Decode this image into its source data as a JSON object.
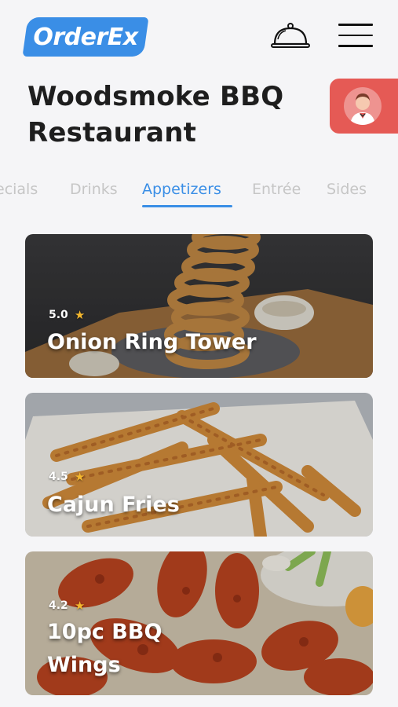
{
  "brand": {
    "logo_text": "OrderEx",
    "accent_color": "#3a8ee6",
    "highlight_color": "#e55a55"
  },
  "header": {
    "cloche_icon": "service-bell-icon",
    "menu_icon": "hamburger-menu-icon"
  },
  "restaurant": {
    "name_line1": "Woodsmoke BBQ",
    "name_line2": "Restaurant"
  },
  "tabs": [
    {
      "label": "ecials"
    },
    {
      "label": "Drinks"
    },
    {
      "label": "Appetizers",
      "active": true
    },
    {
      "label": "Entrée"
    },
    {
      "label": "Sides"
    }
  ],
  "items": [
    {
      "rating": "5.0",
      "name": "Onion Ring Tower"
    },
    {
      "rating": "4.5",
      "name": "Cajun Fries"
    },
    {
      "rating": "4.2",
      "name_line1": "10pc BBQ",
      "name_line2": "Wings"
    }
  ]
}
